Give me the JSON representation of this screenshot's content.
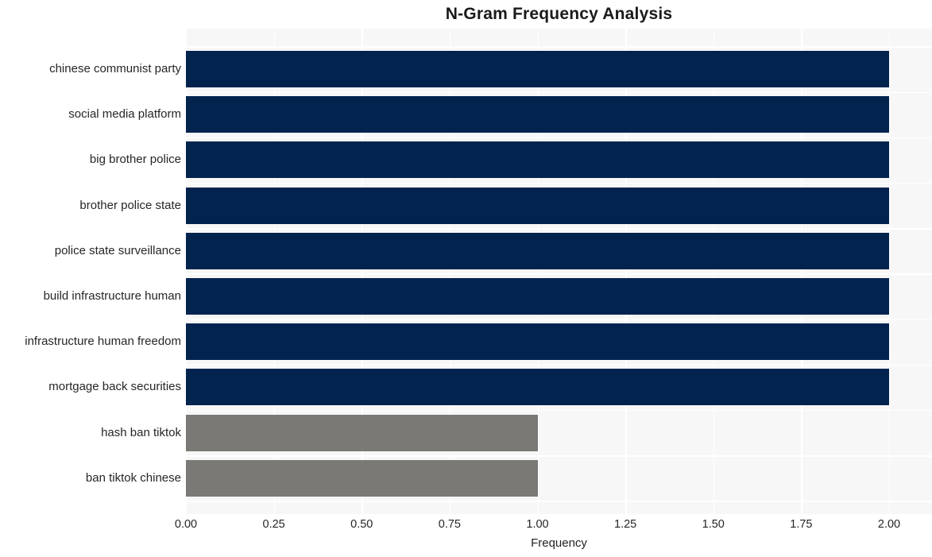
{
  "chart_data": {
    "type": "bar",
    "orientation": "horizontal",
    "title": "N-Gram Frequency Analysis",
    "xlabel": "Frequency",
    "ylabel": "",
    "xlim": [
      0,
      2
    ],
    "ylim": null,
    "grid": true,
    "legend": null,
    "xticks": [
      "0.00",
      "0.25",
      "0.50",
      "0.75",
      "1.00",
      "1.25",
      "1.50",
      "1.75",
      "2.00"
    ],
    "xtick_values": [
      0,
      0.25,
      0.5,
      0.75,
      1,
      1.25,
      1.5,
      1.75,
      2
    ],
    "categories": [
      "chinese communist party",
      "social media platform",
      "big brother police",
      "brother police state",
      "police state surveillance",
      "build infrastructure human",
      "infrastructure human freedom",
      "mortgage back securities",
      "hash ban tiktok",
      "ban tiktok chinese"
    ],
    "values": [
      2,
      2,
      2,
      2,
      2,
      2,
      2,
      2,
      1,
      1
    ],
    "bar_colors": [
      "#03234f",
      "#03234f",
      "#03234f",
      "#03234f",
      "#03234f",
      "#03234f",
      "#03234f",
      "#03234f",
      "#7b7975",
      "#7b7975"
    ]
  },
  "style": {
    "figure_background": "#ffffff",
    "plot_background": "#f7f7f7",
    "grid_color": "#ffffff",
    "text_color": "#262626",
    "title_color": "#1a1a1a",
    "bar_color_primary": "#03234f",
    "bar_color_secondary": "#7b7975"
  }
}
